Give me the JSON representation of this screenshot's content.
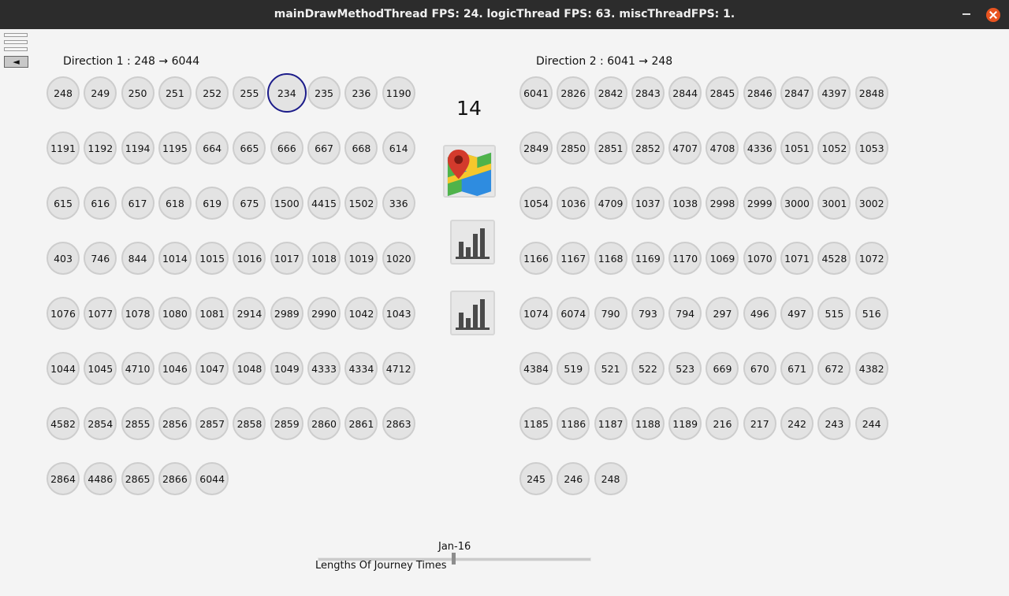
{
  "window": {
    "title": "mainDrawMethodThread FPS: 24. logicThread FPS: 63. miscThreadFPS: 1."
  },
  "toolbar": {
    "back_label": "◄"
  },
  "direction1": {
    "label": "Direction 1 : 248 → 6044",
    "selected_stop": "234",
    "stops": [
      "248",
      "249",
      "250",
      "251",
      "252",
      "255",
      "234",
      "235",
      "236",
      "1190",
      "1191",
      "1192",
      "1194",
      "1195",
      "664",
      "665",
      "666",
      "667",
      "668",
      "614",
      "615",
      "616",
      "617",
      "618",
      "619",
      "675",
      "1500",
      "4415",
      "1502",
      "336",
      "403",
      "746",
      "844",
      "1014",
      "1015",
      "1016",
      "1017",
      "1018",
      "1019",
      "1020",
      "1076",
      "1077",
      "1078",
      "1080",
      "1081",
      "2914",
      "2989",
      "2990",
      "1042",
      "1043",
      "1044",
      "1045",
      "4710",
      "1046",
      "1047",
      "1048",
      "1049",
      "4333",
      "4334",
      "4712",
      "4582",
      "2854",
      "2855",
      "2856",
      "2857",
      "2858",
      "2859",
      "2860",
      "2861",
      "2863",
      "2864",
      "4486",
      "2865",
      "2866",
      "6044"
    ]
  },
  "direction2": {
    "label": "Direction 2 : 6041 → 248",
    "stops": [
      "6041",
      "2826",
      "2842",
      "2843",
      "2844",
      "2845",
      "2846",
      "2847",
      "4397",
      "2848",
      "2849",
      "2850",
      "2851",
      "2852",
      "4707",
      "4708",
      "4336",
      "1051",
      "1052",
      "1053",
      "1054",
      "1036",
      "4709",
      "1037",
      "1038",
      "2998",
      "2999",
      "3000",
      "3001",
      "3002",
      "1166",
      "1167",
      "1168",
      "1169",
      "1170",
      "1069",
      "1070",
      "1071",
      "4528",
      "1072",
      "1074",
      "6074",
      "790",
      "793",
      "794",
      "297",
      "496",
      "497",
      "515",
      "516",
      "4384",
      "519",
      "521",
      "522",
      "523",
      "669",
      "670",
      "671",
      "672",
      "4382",
      "1185",
      "1186",
      "1187",
      "1188",
      "1189",
      "216",
      "217",
      "242",
      "243",
      "244",
      "245",
      "246",
      "248"
    ]
  },
  "center": {
    "count": "14",
    "icons": [
      "map-icon",
      "bar-chart-icon",
      "bar-chart-icon"
    ]
  },
  "slider": {
    "value_label": "Jan-16",
    "caption": "Lengths Of Journey Times",
    "position_fraction": 0.5
  },
  "colors": {
    "titlebar": "#2c2c2c",
    "close_button": "#e95420",
    "selected_ring": "#1c1c8a",
    "stop_fill": "#e3e3e3"
  }
}
